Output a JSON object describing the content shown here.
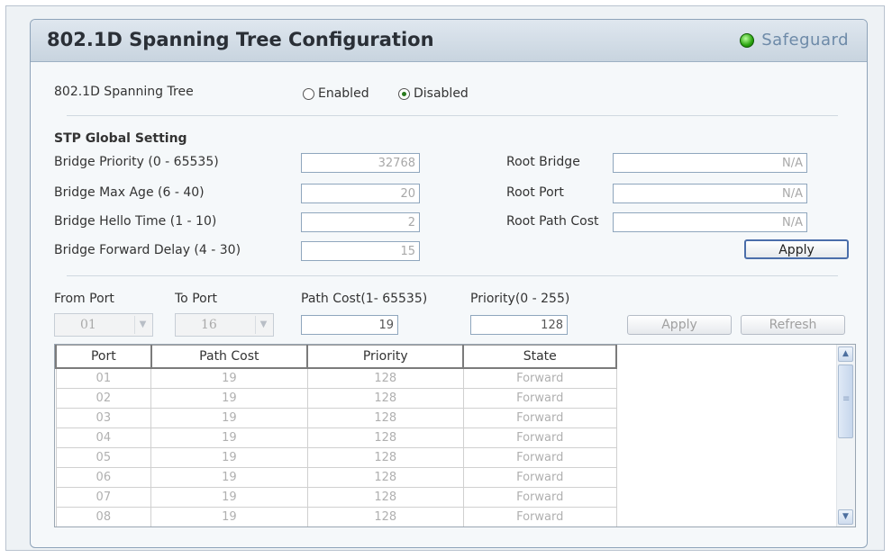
{
  "header": {
    "title": "802.1D Spanning Tree Configuration",
    "brand": "Safeguard"
  },
  "stp_state": {
    "label": "802.1D Spanning Tree",
    "options": [
      {
        "label": "Enabled",
        "selected": false
      },
      {
        "label": "Disabled",
        "selected": true
      }
    ]
  },
  "global": {
    "section_title": "STP Global Setting",
    "bridge_priority": {
      "label": "Bridge Priority (0 - 65535)",
      "value": "32768"
    },
    "bridge_max_age": {
      "label": "Bridge Max Age (6 - 40)",
      "value": "20"
    },
    "bridge_hello_time": {
      "label": "Bridge Hello Time (1 - 10)",
      "value": "2"
    },
    "bridge_forward_delay": {
      "label": "Bridge Forward  Delay (4 - 30)",
      "value": "15"
    },
    "root_bridge": {
      "label": "Root Bridge",
      "value": "N/A"
    },
    "root_port": {
      "label": "Root Port",
      "value": "N/A"
    },
    "root_path_cost": {
      "label": "Root Path Cost",
      "value": "N/A"
    },
    "apply_label": "Apply"
  },
  "port_settings": {
    "from_port": {
      "label": "From Port",
      "value": "01"
    },
    "to_port": {
      "label": "To Port",
      "value": "16"
    },
    "path_cost": {
      "label": "Path Cost(1- 65535)",
      "value": "19"
    },
    "priority": {
      "label": "Priority(0 - 255)",
      "value": "128"
    },
    "apply_label": "Apply",
    "refresh_label": "Refresh"
  },
  "table": {
    "columns": [
      "Port",
      "Path Cost",
      "Priority",
      "State"
    ],
    "rows": [
      [
        "01",
        "19",
        "128",
        "Forward"
      ],
      [
        "02",
        "19",
        "128",
        "Forward"
      ],
      [
        "03",
        "19",
        "128",
        "Forward"
      ],
      [
        "04",
        "19",
        "128",
        "Forward"
      ],
      [
        "05",
        "19",
        "128",
        "Forward"
      ],
      [
        "06",
        "19",
        "128",
        "Forward"
      ],
      [
        "07",
        "19",
        "128",
        "Forward"
      ],
      [
        "08",
        "19",
        "128",
        "Forward"
      ]
    ]
  },
  "colors": {
    "title_bar": "#c8d4df",
    "brand_text": "#6d8aa8",
    "status_led": "#2aa40f",
    "apply_border": "#4b6eaa"
  },
  "icons": {
    "status": "status-led-icon",
    "scroll_up": "arrow-up-icon",
    "scroll_down": "arrow-down-icon",
    "dropdown": "chevron-down-icon"
  }
}
